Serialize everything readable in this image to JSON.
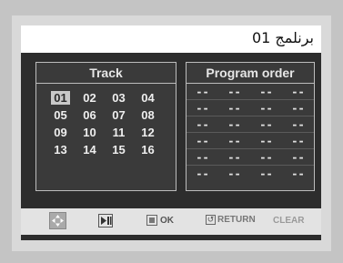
{
  "title": "برنلمج 01",
  "track_panel": {
    "header": "Track",
    "tracks": [
      "01",
      "02",
      "03",
      "04",
      "05",
      "06",
      "07",
      "08",
      "09",
      "10",
      "11",
      "12",
      "13",
      "14",
      "15",
      "16"
    ],
    "selected_index": 0
  },
  "program_panel": {
    "header": "Program order",
    "rows": [
      [
        "--",
        "--",
        "--",
        "--"
      ],
      [
        "--",
        "--",
        "--",
        "--"
      ],
      [
        "--",
        "--",
        "--",
        "--"
      ],
      [
        "--",
        "--",
        "--",
        "--"
      ],
      [
        "--",
        "--",
        "--",
        "--"
      ],
      [
        "--",
        "--",
        "--",
        "--"
      ]
    ]
  },
  "button_bar": {
    "ok_label": "OK",
    "return_label": "RETURN",
    "clear_label": "CLEAR"
  },
  "icons": {
    "navigate": "navigate-cross-icon",
    "play_pause": "play-pause-icon",
    "ok": "enter-icon",
    "return": "return-icon"
  }
}
